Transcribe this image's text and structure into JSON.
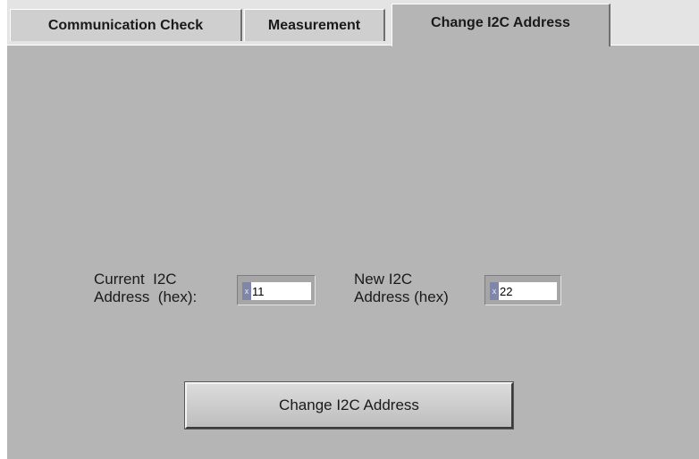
{
  "tabs": [
    {
      "label": "Communication Check",
      "active": false
    },
    {
      "label": "Measurement",
      "active": false
    },
    {
      "label": "Change I2C Address",
      "active": true
    }
  ],
  "current_address": {
    "label_line1": "Current  I2C",
    "label_line2": "Address  (hex):",
    "radix": "x",
    "value": "11"
  },
  "new_address": {
    "label_line1": "New I2C",
    "label_line2": "Address (hex)",
    "radix": "x",
    "value": "22"
  },
  "change_button": {
    "label": "Change I2C Address"
  },
  "colors": {
    "panel": "#b5b5b5",
    "tabstrip": "#e4e4e4",
    "tab_inactive": "#cfcfcf"
  }
}
